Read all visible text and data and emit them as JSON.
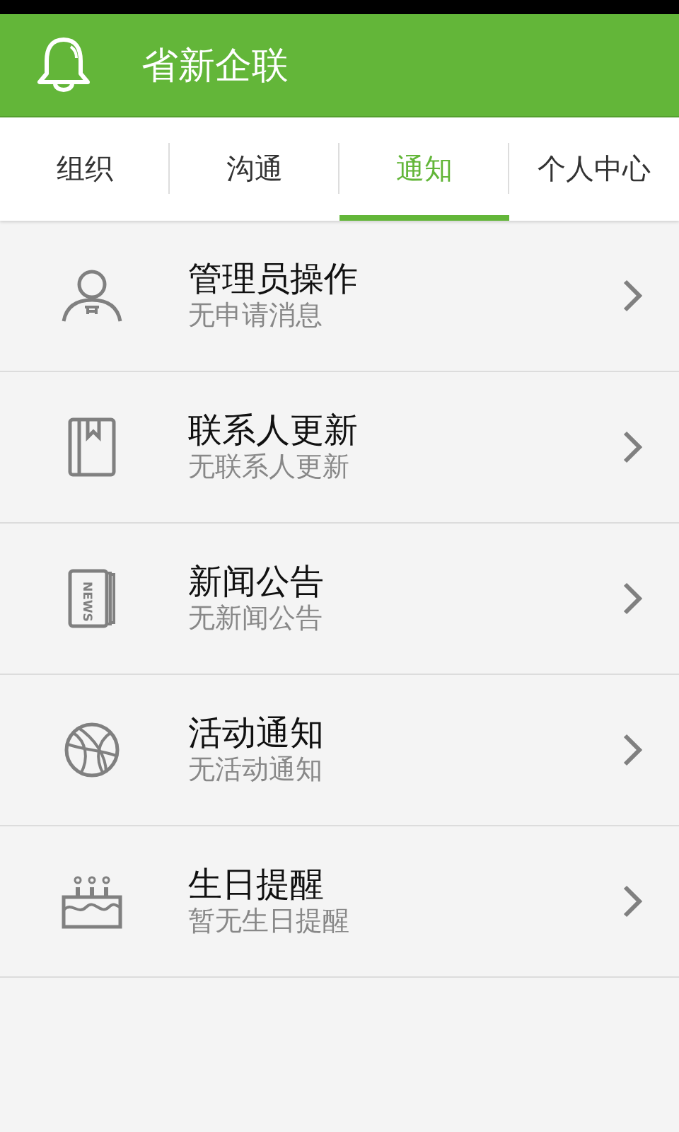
{
  "app_bar": {
    "title": "省新企联"
  },
  "tabs": [
    {
      "label": "组织",
      "selected": false
    },
    {
      "label": "沟通",
      "selected": false
    },
    {
      "label": "通知",
      "selected": true
    },
    {
      "label": "个人中心",
      "selected": false
    }
  ],
  "items": [
    {
      "kind": "admin",
      "title": "管理员操作",
      "subtitle": "无申请消息"
    },
    {
      "kind": "contacts",
      "title": "联系人更新",
      "subtitle": "无联系人更新"
    },
    {
      "kind": "news",
      "title": "新闻公告",
      "subtitle": "无新闻公告",
      "icon_label": "NEWS"
    },
    {
      "kind": "activity",
      "title": "活动通知",
      "subtitle": "无活动通知"
    },
    {
      "kind": "birthday",
      "title": "生日提醒",
      "subtitle": "暂无生日提醒"
    }
  ]
}
